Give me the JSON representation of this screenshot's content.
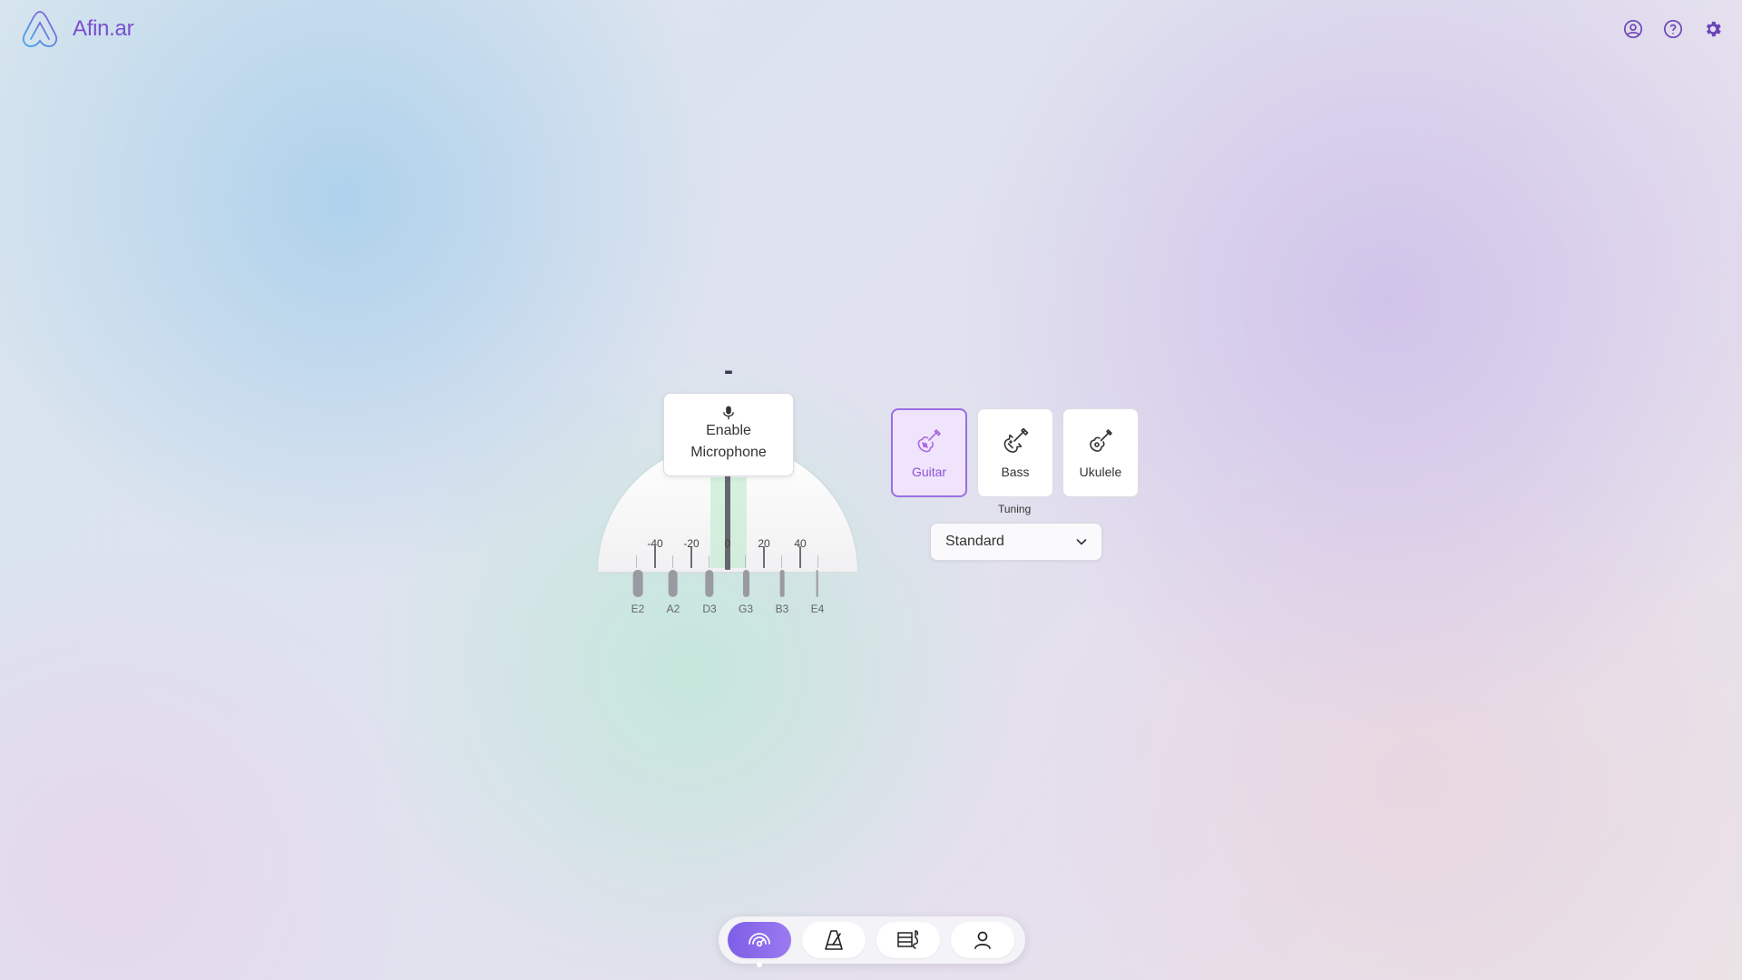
{
  "app": {
    "title": "Afin.ar"
  },
  "header": {
    "icons": [
      "user-circle-icon",
      "help-icon",
      "gear-icon"
    ]
  },
  "tuner": {
    "note": "-",
    "gauge_labels": [
      "-40",
      "-20",
      "0",
      "20",
      "40"
    ],
    "microphone_button": {
      "line1": "Enable",
      "line2": "Microphone"
    },
    "strings": [
      "E2",
      "A2",
      "D3",
      "G3",
      "B3",
      "E4"
    ]
  },
  "instruments": [
    {
      "label": "Guitar",
      "selected": true
    },
    {
      "label": "Bass",
      "selected": false
    },
    {
      "label": "Ukulele",
      "selected": false
    }
  ],
  "tuning": {
    "label": "Tuning",
    "value": "Standard"
  },
  "bottom_nav": {
    "items": [
      "tuner-icon",
      "metronome-icon",
      "chord-chart-icon",
      "profile-icon"
    ],
    "active": 0
  },
  "colors": {
    "accent": "#8e52d8",
    "active_nav": "#7e5ee6"
  }
}
